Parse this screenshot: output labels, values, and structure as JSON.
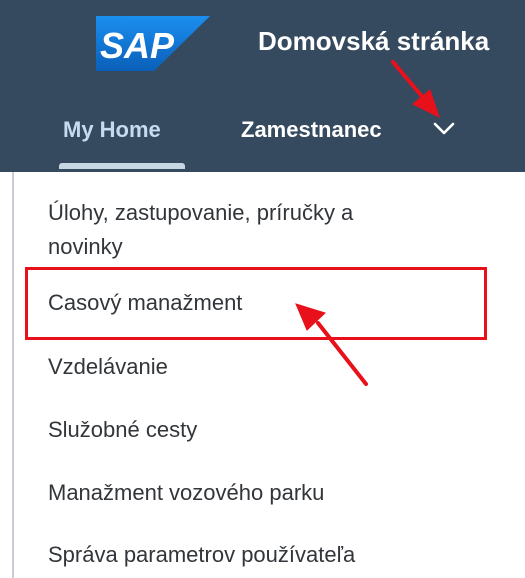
{
  "header": {
    "logo_text": "SAP",
    "title": "Domovská stránka",
    "tabs": [
      {
        "label": "My Home"
      },
      {
        "label": "Zamestnanec"
      }
    ]
  },
  "menu": {
    "items": [
      {
        "label_line1": "Úlohy, zastupovanie, príručky a",
        "label_line2": "novinky"
      },
      {
        "label": "Casový manažment"
      },
      {
        "label": "Vzdelávanie"
      },
      {
        "label": "Služobné cesty"
      },
      {
        "label": "Manažment vozového parku"
      },
      {
        "label": "Správa parametrov používateľa"
      }
    ]
  },
  "colors": {
    "shell": "#354a5f",
    "highlight": "#e8101a",
    "sap_blue": "#0a6ed1"
  }
}
